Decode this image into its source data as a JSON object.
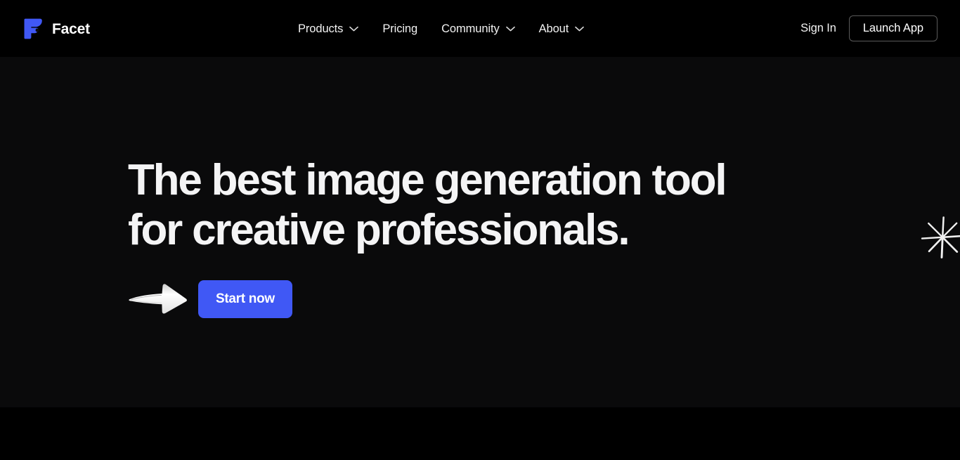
{
  "theme": {
    "page_bg": "#000000",
    "hero_bg": "#0a0a0b",
    "accent": "#4058f5",
    "text_primary": "#f4f4f5",
    "text_nav": "#f2f2f2",
    "border_subtle": "#5a5a5a"
  },
  "header": {
    "brand": {
      "name": "Facet",
      "logo_icon": "facet-f-logo-icon",
      "logo_color": "#4058f5"
    },
    "nav": [
      {
        "label": "Products",
        "has_dropdown": true,
        "icon": "chevron-down-icon"
      },
      {
        "label": "Pricing",
        "has_dropdown": false,
        "icon": ""
      },
      {
        "label": "Community",
        "has_dropdown": true,
        "icon": "chevron-down-icon"
      },
      {
        "label": "About",
        "has_dropdown": true,
        "icon": "chevron-down-icon"
      }
    ],
    "sign_in_label": "Sign In",
    "launch_app_label": "Launch App"
  },
  "hero": {
    "headline": "The best image generation tool\nfor creative professionals.",
    "headline_line_1": "The best image generation tool",
    "headline_line_2": "for creative professionals.",
    "cta_label": "Start now",
    "arrow_icon": "hand-drawn-arrow-right-icon",
    "sparkle_icon": "hand-drawn-sparkle-asterisk-icon"
  }
}
